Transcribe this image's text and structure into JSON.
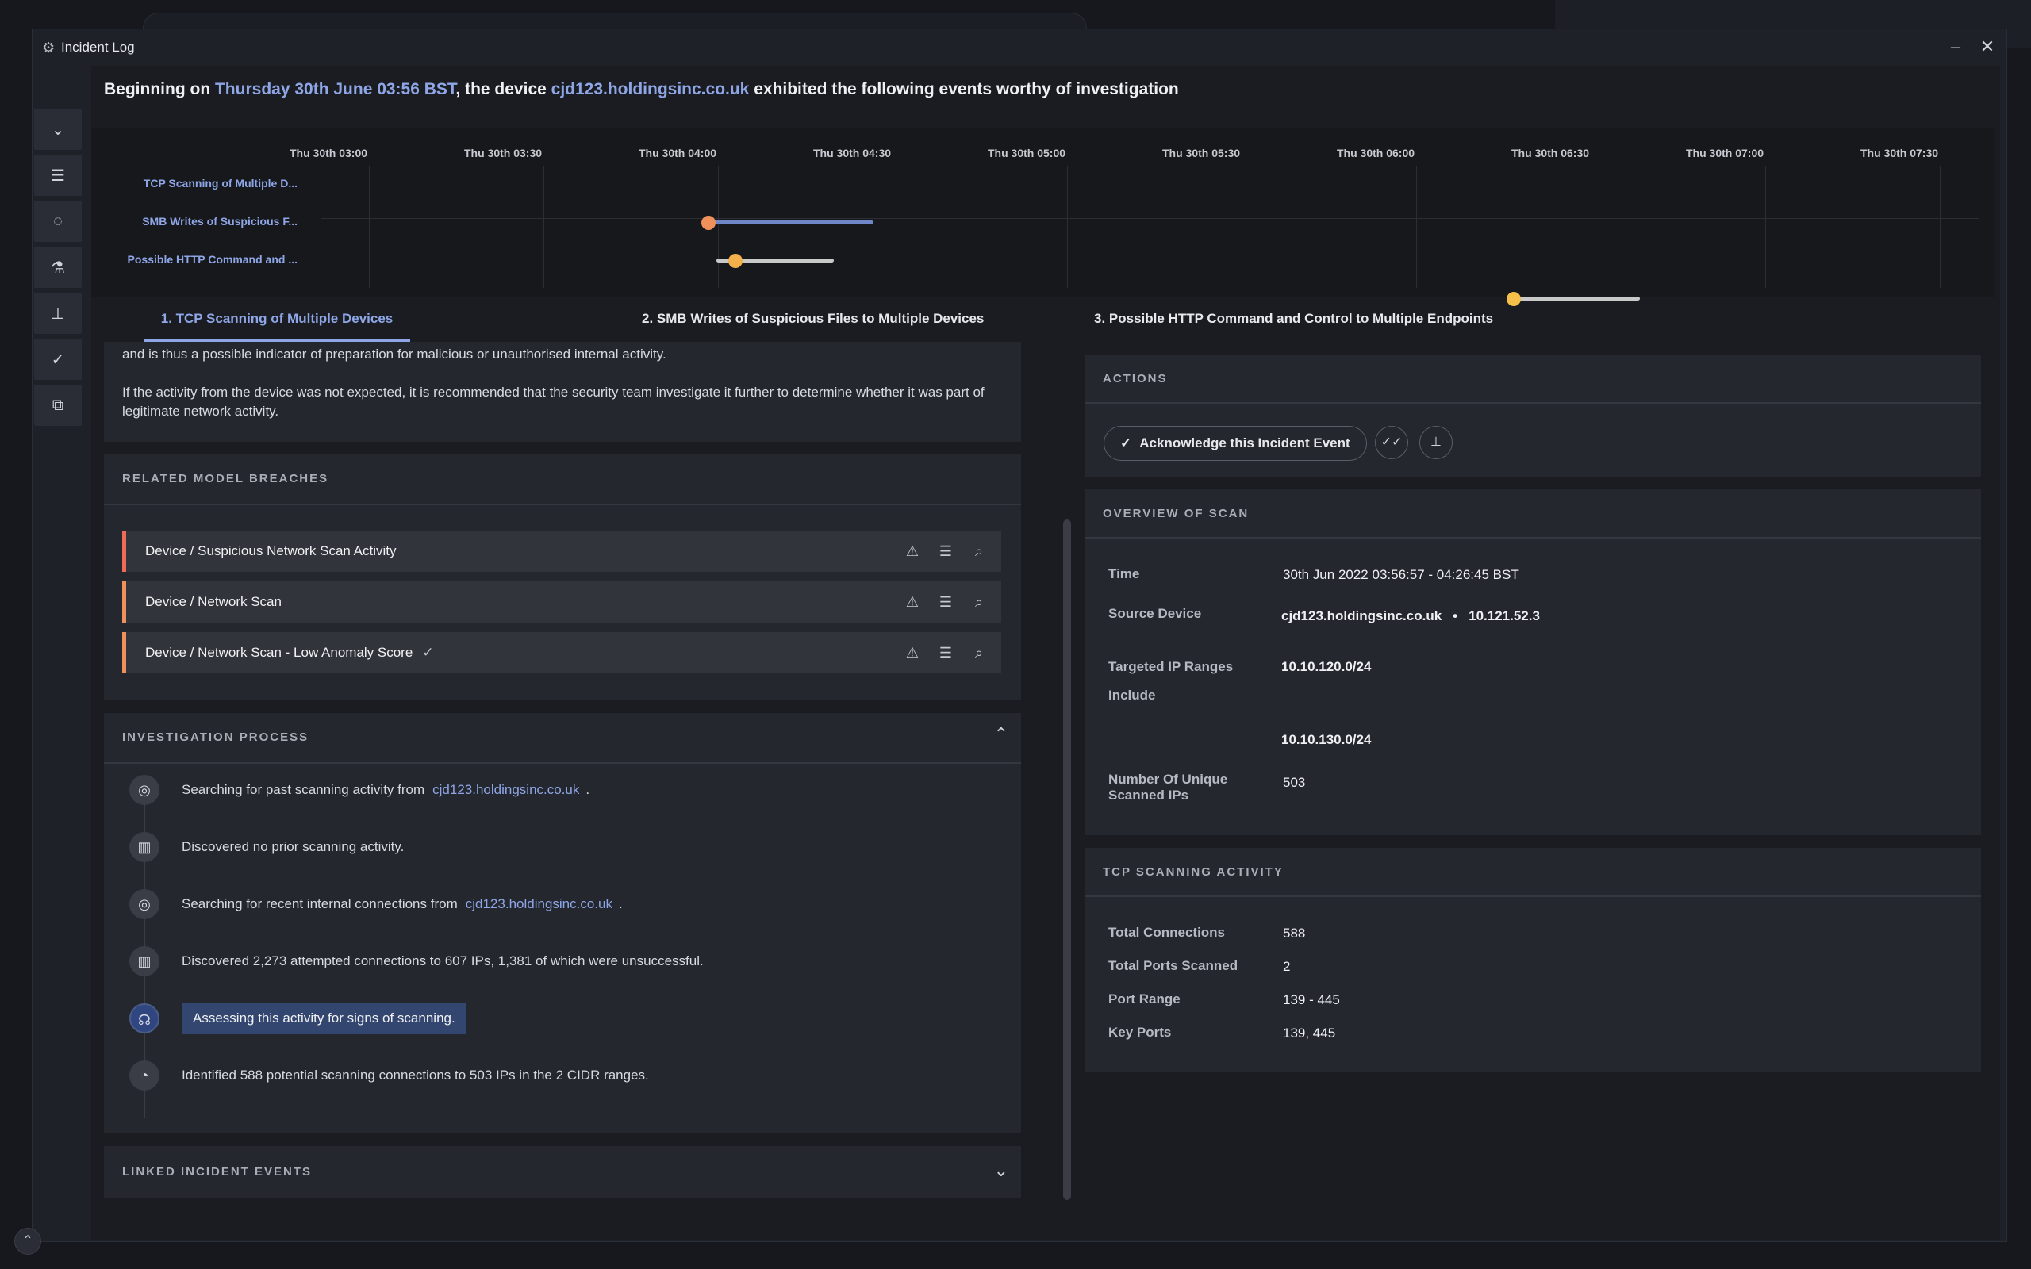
{
  "window": {
    "title": "Incident Log",
    "minimize": "–",
    "close": "✕"
  },
  "sidebar": [
    {
      "icon": "chevrons-down-icon",
      "glyph": "⌄"
    },
    {
      "icon": "list-icon",
      "glyph": "☰"
    },
    {
      "icon": "comment-icon",
      "glyph": "◌"
    },
    {
      "icon": "flask-icon",
      "glyph": "⚗"
    },
    {
      "icon": "pin-icon",
      "glyph": "📌"
    },
    {
      "icon": "check-icon",
      "glyph": "✓"
    },
    {
      "icon": "copy-icon",
      "glyph": "⧉"
    }
  ],
  "headline": {
    "prefix": "Beginning on ",
    "date": "Thursday 30th June 03:56 BST",
    "middle": ", the device ",
    "device": "cjd123.holdingsinc.co.uk",
    "suffix": " exhibited the following events worthy of investigation"
  },
  "timeline": {
    "ticks": [
      "Thu 30th 03:00",
      "Thu 30th 03:30",
      "Thu 30th 04:00",
      "Thu 30th 04:30",
      "Thu 30th 05:00",
      "Thu 30th 05:30",
      "Thu 30th 06:00",
      "Thu 30th 06:30",
      "Thu 30th 07:00",
      "Thu 30th 07:30"
    ],
    "rows": [
      {
        "label": "TCP Scanning of Multiple D...",
        "bar_color": "#6f86c9",
        "dot_color": "#f0905a"
      },
      {
        "label": "SMB Writes of Suspicious F...",
        "bar_color": "#c9c9c9",
        "dot_color": "#f4b04a"
      },
      {
        "label": "Possible HTTP Command and ...",
        "bar_color": "#c9c9c9",
        "dot_color": "#f4c04a"
      }
    ]
  },
  "tabs": [
    {
      "label": "1. TCP Scanning of Multiple Devices"
    },
    {
      "label": "2. SMB Writes of Suspicious Files to Multiple Devices"
    },
    {
      "label": "3. Possible HTTP Command and Control to Multiple Endpoints"
    }
  ],
  "description": {
    "p1": "and is thus a possible indicator of preparation for malicious or unauthorised internal activity.",
    "p2": "If the activity from the device was not expected, it is recommended that the security team investigate it further to determine whether it was part of legitimate network activity."
  },
  "related": {
    "title": "Related Model Breaches",
    "items": [
      {
        "label": "Device / Suspicious Network Scan Activity",
        "check": ""
      },
      {
        "label": "Device / Network Scan",
        "check": ""
      },
      {
        "label": "Device / Network Scan - Low Anomaly Score",
        "check": "✓"
      }
    ]
  },
  "investigation": {
    "title": "Investigation Process",
    "steps": [
      {
        "icon": "radar-icon",
        "glyph": "◎",
        "text": "Searching for past scanning activity from",
        "link": "cjd123.holdingsinc.co.uk",
        "after": "."
      },
      {
        "icon": "bar-chart-icon",
        "glyph": "▥",
        "text": "Discovered no prior scanning activity.",
        "link": "",
        "after": ""
      },
      {
        "icon": "radar-icon",
        "glyph": "◎",
        "text": "Searching for recent internal connections from",
        "link": "cjd123.holdingsinc.co.uk",
        "after": "."
      },
      {
        "icon": "bar-chart-icon",
        "glyph": "▥",
        "text": "Discovered 2,273 attempted connections to 607 IPs, 1,381 of which were unsuccessful.",
        "link": "",
        "after": ""
      },
      {
        "icon": "brain-icon",
        "glyph": "☊",
        "text": "Assessing this activity for signs of scanning.",
        "link": "",
        "after": ""
      },
      {
        "icon": "result-icon",
        "glyph": "◔",
        "text": "Identified 588 potential scanning connections to 503 IPs in the 2 CIDR ranges.",
        "link": "",
        "after": ""
      }
    ]
  },
  "linked": {
    "title": "Linked Incident Events"
  },
  "actions": {
    "title": "Actions",
    "ack_label": "Acknowledge this Incident Event"
  },
  "overview": {
    "title": "Overview of Scan",
    "time_key": "Time",
    "time_val": "30th Jun 2022 03:56:57 - 04:26:45 BST",
    "source_key": "Source Device",
    "source_host": "cjd123.holdingsinc.co.uk",
    "source_sep": "•",
    "source_ip": "10.121.52.3",
    "ranges_key": "Targeted IP Ranges Include",
    "range1": "10.10.120.0/24",
    "range2": "10.10.130.0/24",
    "unique_key": "Number Of Unique Scanned IPs",
    "unique_val": "503"
  },
  "tcp": {
    "title": "TCP Scanning Activity",
    "rows": [
      {
        "key": "Total Connections",
        "val": "588"
      },
      {
        "key": "Total Ports Scanned",
        "val": "2"
      },
      {
        "key": "Port Range",
        "val": "139 - 445"
      },
      {
        "key": "Key Ports",
        "val": "139, 445"
      }
    ]
  }
}
